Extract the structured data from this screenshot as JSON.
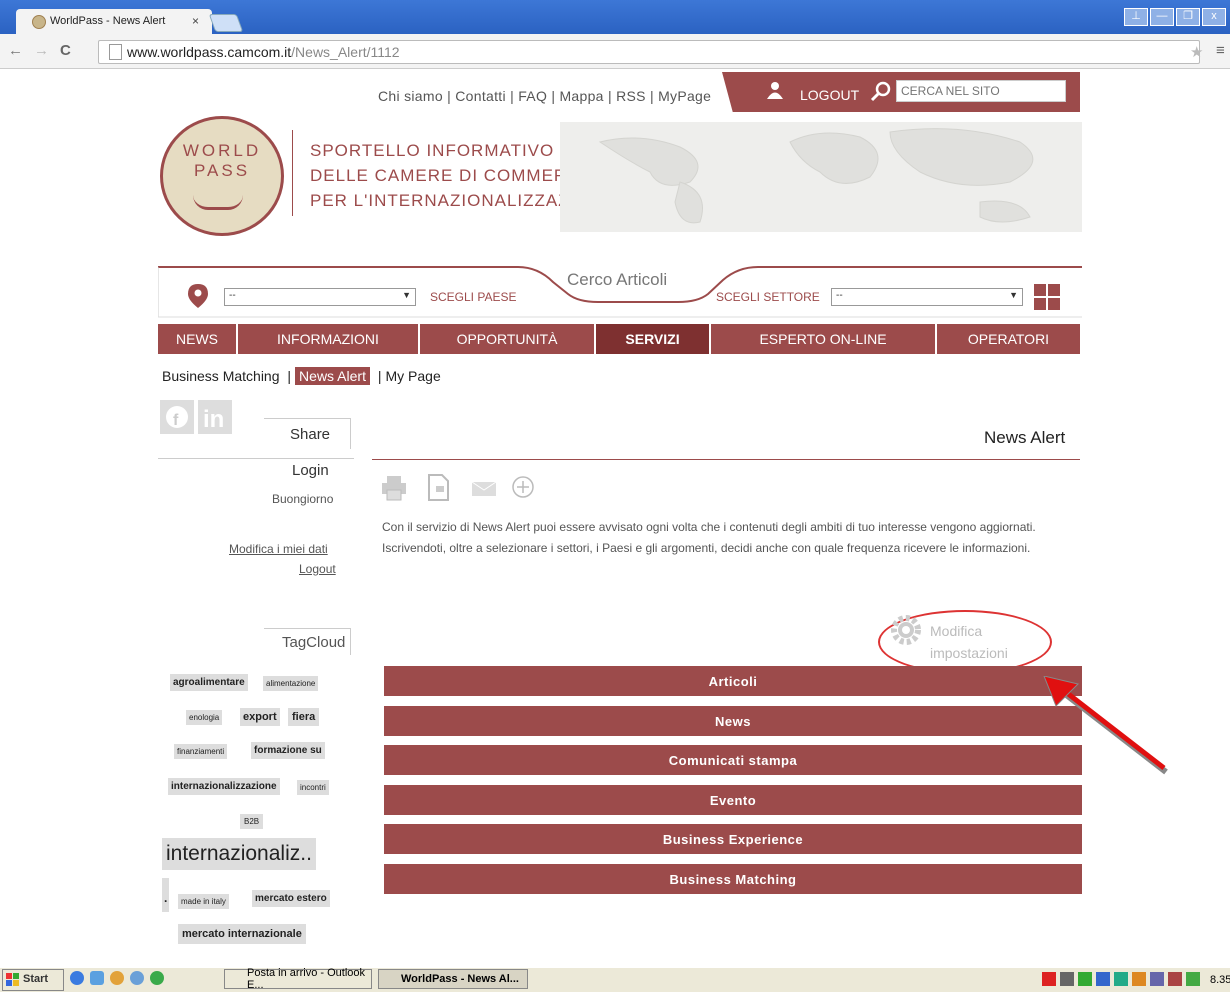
{
  "browser": {
    "tab_title": "WorldPass - News Alert",
    "tab_close": "×",
    "url_host": "www.worldpass.camcom.it",
    "url_path": "/News_Alert/1112",
    "back": "←",
    "forward": "→",
    "reload": "C",
    "star": "★",
    "menu": "≡",
    "win_buttons": [
      "⊥",
      "—",
      "❐",
      "x"
    ]
  },
  "header": {
    "top_links": "Chi siamo | Contatti | FAQ | Mappa | RSS | MyPage",
    "logout": "LOGOUT",
    "search_placeholder": "CERCA NEL SITO",
    "logo_line1": "WORLD",
    "logo_line2": "PASS",
    "tagline": [
      "SPORTELLO INFORMATIVO",
      "DELLE CAMERE DI COMMERCIO",
      "PER L'INTERNAZIONALIZZAZIONE"
    ]
  },
  "filter": {
    "title": "Cerco Articoli",
    "country_select": "--",
    "country_label": "SCEGLI PAESE",
    "sector_label": "SCEGLI SETTORE",
    "sector_select": "--"
  },
  "main_nav": [
    {
      "label": "NEWS",
      "active": false
    },
    {
      "label": "INFORMAZIONI",
      "active": false
    },
    {
      "label": "OPPORTUNITÀ",
      "active": false
    },
    {
      "label": "SERVIZI",
      "active": true
    },
    {
      "label": "ESPERTO ON-LINE",
      "active": false
    },
    {
      "label": "OPERATORI",
      "active": false
    }
  ],
  "sub_nav": {
    "item1": "Business Matching",
    "sep": "|",
    "item2": "News Alert",
    "item3": "My Page"
  },
  "sidebar": {
    "share": "Share",
    "login_title": "Login",
    "greeting": "Buongiorno",
    "edit_data": "Modifica i miei dati",
    "logout": "Logout",
    "tagcloud_title": "TagCloud",
    "tags": [
      "agroalimentare",
      "alimentazione",
      "enologia",
      "export",
      "fiera",
      "finanziamenti",
      "formazione su",
      "internazionalizzazione",
      "incontri",
      "B2B",
      "internazionaliz..",
      ".",
      "made in italy",
      "mercato estero",
      "mercato internazionale"
    ]
  },
  "content": {
    "title": "News Alert",
    "description": "Con il servizio di News Alert puoi essere avvisato ogni volta che i contenuti degli ambiti di tuo interesse vengono aggiornati. Iscrivendoti, oltre a selezionare i settori, i Paesi e gli argomenti, decidi anche con quale frequenza ricevere le informazioni.",
    "settings_label_1": "Modifica",
    "settings_label_2": "impostazioni",
    "categories": [
      "Articoli",
      "News",
      "Comunicati stampa",
      "Evento",
      "Business Experience",
      "Business Matching"
    ]
  },
  "taskbar": {
    "start": "Start",
    "task1": "Posta in arrivo - Outlook E...",
    "task2": "WorldPass - News Al...",
    "clock": "8.35"
  }
}
